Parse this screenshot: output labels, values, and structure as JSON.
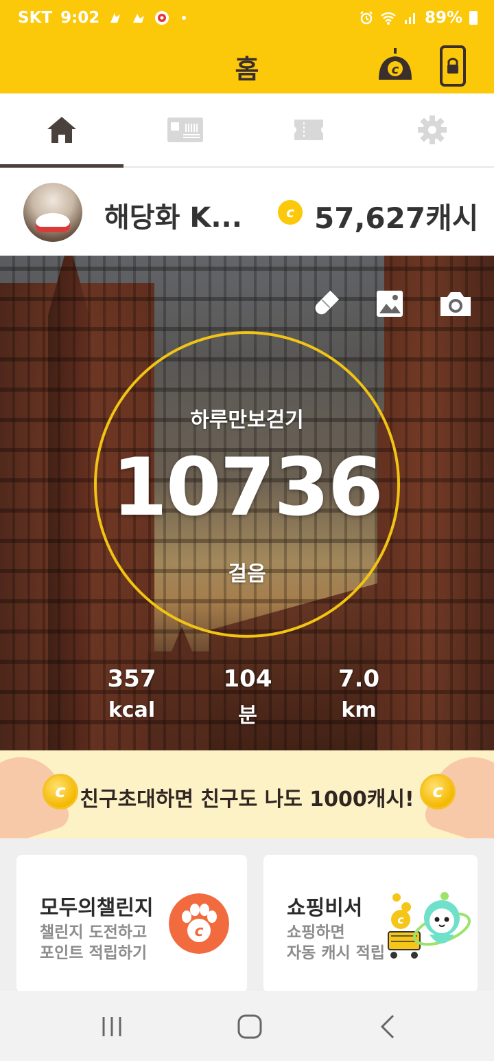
{
  "status": {
    "carrier": "SKT",
    "time": "9:02",
    "battery": "89%"
  },
  "appbar": {
    "title": "홈"
  },
  "tabs": [
    {
      "name": "home",
      "icon": "home-icon",
      "active": true
    },
    {
      "name": "coupon",
      "icon": "coupon-icon",
      "active": false
    },
    {
      "name": "ticket",
      "icon": "ticket-icon",
      "active": false
    },
    {
      "name": "settings",
      "icon": "gear-icon",
      "active": false
    }
  ],
  "profile": {
    "username": "해당화 K...",
    "cash": "57,627캐시",
    "coin_symbol": "c"
  },
  "hero": {
    "label": "하루만보걷기",
    "steps": "10736",
    "steps_unit": "걸음",
    "stats": [
      {
        "value": "357",
        "unit": "kcal"
      },
      {
        "value": "104",
        "unit": "분"
      },
      {
        "value": "7.0",
        "unit": "km"
      }
    ]
  },
  "banner": {
    "text": "친구초대하면 친구도 나도 1000캐시!"
  },
  "cards": [
    {
      "title": "모두의챌린지",
      "line1": "챌린지 도전하고",
      "line2": "포인트 적립하기"
    },
    {
      "title": "쇼핑비서",
      "line1": "쇼핑하면",
      "line2": "자동 캐시 적립"
    }
  ],
  "colors": {
    "brand": "#fcc80a",
    "ring": "#f2c414",
    "accent_orange": "#f26b3f"
  }
}
